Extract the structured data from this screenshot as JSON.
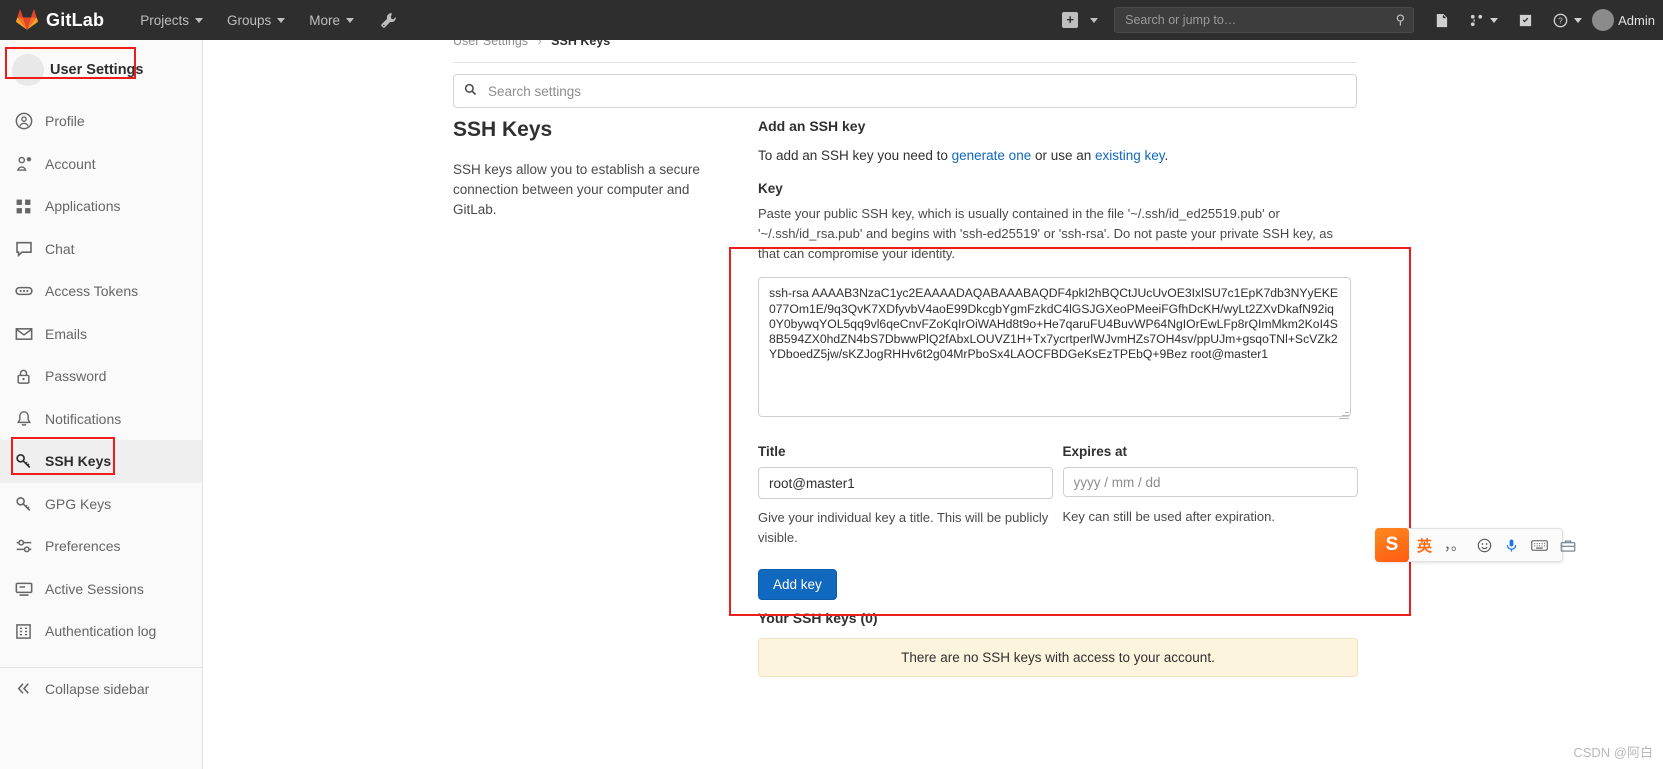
{
  "navbar": {
    "brand": "GitLab",
    "items": [
      {
        "label": "Projects",
        "icon": "chevron-down-icon"
      },
      {
        "label": "Groups",
        "icon": "chevron-down-icon"
      },
      {
        "label": "More",
        "icon": "chevron-down-icon"
      }
    ],
    "wrench_icon": "wrench-icon",
    "create_new": {
      "icon": "plus-icon",
      "label": ""
    },
    "search": {
      "placeholder": "Search or jump to…",
      "value": "",
      "icon": "search-icon"
    },
    "right_icons": [
      "issues-icon",
      "merge-requests-icon",
      "todos-icon",
      "help-icon"
    ],
    "user": {
      "label": "Admin",
      "avatar": "avatar"
    },
    "bg_color": "#2e2e2e"
  },
  "sidebar": {
    "header": {
      "avatar_label": "Admin",
      "title": "User Settings"
    },
    "items": [
      {
        "label": "Profile",
        "icon": "user-circle-icon",
        "active": false
      },
      {
        "label": "Account",
        "icon": "account-gear-icon",
        "active": false
      },
      {
        "label": "Applications",
        "icon": "applications-grid-icon",
        "active": false
      },
      {
        "label": "Chat",
        "icon": "chat-bubble-icon",
        "active": false
      },
      {
        "label": "Access Tokens",
        "icon": "token-pill-icon",
        "active": false
      },
      {
        "label": "Emails",
        "icon": "envelope-icon",
        "active": false
      },
      {
        "label": "Password",
        "icon": "lock-icon",
        "active": false
      },
      {
        "label": "Notifications",
        "icon": "bell-icon",
        "active": false
      },
      {
        "label": "SSH Keys",
        "icon": "key-icon",
        "active": true
      },
      {
        "label": "GPG Keys",
        "icon": "key-icon",
        "active": false
      },
      {
        "label": "Preferences",
        "icon": "sliders-icon",
        "active": false
      },
      {
        "label": "Active Sessions",
        "icon": "monitor-icon",
        "active": false
      },
      {
        "label": "Authentication log",
        "icon": "log-grid-icon",
        "active": false
      }
    ],
    "collapse": {
      "label": "Collapse sidebar",
      "icon": "double-chevron-left-icon"
    }
  },
  "breadcrumb": {
    "root": "User Settings",
    "separator": "›",
    "current": "SSH Keys"
  },
  "settings_search": {
    "placeholder": "Search settings",
    "value": "",
    "icon": "search-icon"
  },
  "page": {
    "title": "SSH Keys",
    "description": "SSH keys allow you to establish a secure connection between your computer and GitLab."
  },
  "form": {
    "heading": "Add an SSH key",
    "intro_prefix": "To add an SSH key you need to ",
    "intro_link1": "generate one",
    "intro_middle": " or use an ",
    "intro_link2": "existing key",
    "intro_suffix": ".",
    "key_label": "Key",
    "key_help": "Paste your public SSH key, which is usually contained in the file '~/.ssh/id_ed25519.pub' or '~/.ssh/id_rsa.pub' and begins with 'ssh-ed25519' or 'ssh-rsa'. Do not paste your private SSH key, as that can compromise your identity.",
    "key_value": "ssh-rsa AAAAB3NzaC1yc2EAAAADAQABAAABAQDF4pkI2hBQCtJUcUvOE3IxlSU7c1EpK7db3NYyEKE077Om1E/9q3QvK7XDfyvbV4aoE99DkcgbYgmFzkdC4lGSJGXeoPMeeiFGfhDcKH/wyLt2ZXvDkafN92iq0Y0bywqYOL5qq9vl6qeCnvFZoKqIrOiWAHd8t9o+He7qaruFU4BuvWP64NgIOrEwLFp8rQImMkm2KoI4S8B594ZX0hdZN4bS7DbwwPlQ2fAbxLOUVZ1H+Tx7ycrtperlWJvmHZs7OH4sv/ppUJm+gsqoTNl+ScVZk2YDboedZ5jw/sKZJogRHHv6t2g04MrPboSx4LAOCFBDGeKsEzTPEbQ+9Bez root@master1",
    "title_label": "Title",
    "title_value": "root@master1",
    "title_hint": "Give your individual key a title. This will be publicly visible.",
    "expires_label": "Expires at",
    "expires_placeholder": "yyyy / mm / dd",
    "expires_value": "",
    "expires_hint": "Key can still be used after expiration.",
    "submit_label": "Add key",
    "submit_color": "#1068bf"
  },
  "your_keys": {
    "heading": "Your SSH keys (0)",
    "empty_message": "There are no SSH keys with access to your account."
  },
  "ime": {
    "logo": "S",
    "mode": "英",
    "punctuation": "，。",
    "emoji_icon": "smiley-icon",
    "mic_icon": "microphone-icon",
    "keyboard_icon": "keyboard-icon",
    "toolbox_icon": "toolbox-icon"
  },
  "watermark": "CSDN @阿白",
  "annotations": {
    "color": "#ee1c1c",
    "boxes": [
      "user-settings-header",
      "ssh-keys-sidebar-item",
      "add-ssh-key-form"
    ]
  }
}
